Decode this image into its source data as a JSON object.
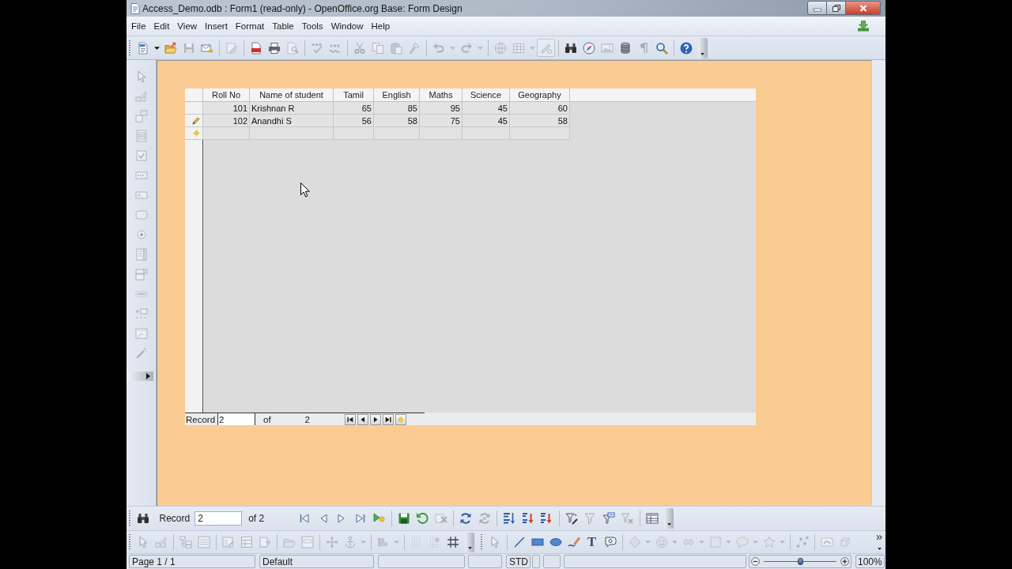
{
  "window": {
    "title": "Access_Demo.odb : Form1 (read-only) - OpenOffice.org Base: Form Design"
  },
  "menu": [
    {
      "label": "File"
    },
    {
      "label": "Edit"
    },
    {
      "label": "View"
    },
    {
      "label": "Insert"
    },
    {
      "label": "Format"
    },
    {
      "label": "Table"
    },
    {
      "label": "Tools"
    },
    {
      "label": "Window"
    },
    {
      "label": "Help"
    }
  ],
  "standard_toolbar": [
    {
      "kind": "new",
      "disabled": false,
      "pressed": false
    },
    {
      "kind": "dropdown",
      "disabled": false,
      "pressed": false
    },
    {
      "kind": "open",
      "disabled": false,
      "pressed": false
    },
    {
      "kind": "save",
      "disabled": true,
      "pressed": false
    },
    {
      "kind": "email",
      "disabled": false,
      "pressed": false
    },
    {
      "kind": "separator"
    },
    {
      "kind": "edit-file",
      "disabled": true,
      "pressed": false
    },
    {
      "kind": "separator"
    },
    {
      "kind": "pdf",
      "disabled": false,
      "pressed": false
    },
    {
      "kind": "print",
      "disabled": false,
      "pressed": false
    },
    {
      "kind": "preview",
      "disabled": true,
      "pressed": false
    },
    {
      "kind": "separator"
    },
    {
      "kind": "spellcheck",
      "disabled": true,
      "pressed": false
    },
    {
      "kind": "autospell",
      "disabled": true,
      "pressed": false
    },
    {
      "kind": "separator"
    },
    {
      "kind": "cut",
      "disabled": true,
      "pressed": false
    },
    {
      "kind": "copy",
      "disabled": true,
      "pressed": false
    },
    {
      "kind": "paste",
      "disabled": true,
      "pressed": false
    },
    {
      "kind": "clone",
      "disabled": true,
      "pressed": false
    },
    {
      "kind": "separator"
    },
    {
      "kind": "undo",
      "disabled": true,
      "pressed": false
    },
    {
      "kind": "dropdown",
      "disabled": true,
      "pressed": false
    },
    {
      "kind": "redo",
      "disabled": true,
      "pressed": false
    },
    {
      "kind": "dropdown",
      "disabled": true,
      "pressed": false
    },
    {
      "kind": "separator"
    },
    {
      "kind": "hyperlink",
      "disabled": true,
      "pressed": false
    },
    {
      "kind": "table",
      "disabled": true,
      "pressed": false
    },
    {
      "kind": "dropdown",
      "disabled": true,
      "pressed": false
    },
    {
      "kind": "draw",
      "disabled": true,
      "pressed": true
    },
    {
      "kind": "separator"
    },
    {
      "kind": "find",
      "disabled": false,
      "pressed": false
    },
    {
      "kind": "navigator",
      "disabled": false,
      "pressed": false
    },
    {
      "kind": "gallery",
      "disabled": true,
      "pressed": false
    },
    {
      "kind": "datasource",
      "disabled": false,
      "pressed": false
    },
    {
      "kind": "nonprint",
      "disabled": true,
      "pressed": false
    },
    {
      "kind": "zoom",
      "disabled": false,
      "pressed": false
    },
    {
      "kind": "separator"
    },
    {
      "kind": "help",
      "disabled": false,
      "pressed": false
    },
    {
      "kind": "overflow"
    }
  ],
  "form_controls_toolbar": [
    {
      "kind": "pointer",
      "disabled": true
    },
    {
      "kind": "design-mode",
      "disabled": true
    },
    {
      "kind": "wizard",
      "disabled": true
    },
    {
      "kind": "form",
      "disabled": true
    },
    {
      "kind": "checkbox",
      "disabled": true
    },
    {
      "kind": "textbox",
      "disabled": true
    },
    {
      "kind": "formatted",
      "disabled": true
    },
    {
      "kind": "push-button",
      "disabled": true
    },
    {
      "kind": "option",
      "disabled": true
    },
    {
      "kind": "listbox",
      "disabled": true
    },
    {
      "kind": "combobox",
      "disabled": true
    },
    {
      "kind": "label",
      "disabled": true
    },
    {
      "kind": "more-controls",
      "disabled": true
    },
    {
      "kind": "form-design",
      "disabled": true
    },
    {
      "kind": "wizards",
      "disabled": true
    },
    {
      "kind": "expand"
    }
  ],
  "form": {
    "grid": {
      "columns": [
        {
          "label": "Roll No",
          "kind": "number"
        },
        {
          "label": "Name of student",
          "kind": "text"
        },
        {
          "label": "Tamil",
          "kind": "number"
        },
        {
          "label": "English",
          "kind": "number"
        },
        {
          "label": "Maths",
          "kind": "number"
        },
        {
          "label": "Science",
          "kind": "number"
        },
        {
          "label": "Geography",
          "kind": "number"
        }
      ],
      "rows": [
        {
          "editing": false,
          "new": false,
          "cells": [
            "101",
            "Krishnan R",
            "65",
            "85",
            "95",
            "45",
            "60"
          ]
        },
        {
          "editing": true,
          "new": false,
          "cells": [
            "102",
            "Anandhi S",
            "56",
            "58",
            "75",
            "45",
            "58"
          ]
        },
        {
          "editing": false,
          "new": true
        }
      ]
    },
    "record_bar": {
      "label": "Record",
      "value": "2",
      "of": "of",
      "total": "2",
      "buttons": [
        {
          "kind": "first"
        },
        {
          "kind": "prev"
        },
        {
          "kind": "next"
        },
        {
          "kind": "last"
        },
        {
          "kind": "new-record"
        }
      ]
    }
  },
  "navigation_toolbar": {
    "leading_buttons": [
      {
        "kind": "find",
        "disabled": false
      }
    ],
    "record_label": "Record",
    "record_value": "2",
    "count": "of 2",
    "buttons": [
      {
        "kind": "first",
        "disabled": false
      },
      {
        "kind": "prev",
        "disabled": false
      },
      {
        "kind": "next",
        "disabled": false
      },
      {
        "kind": "last",
        "disabled": false
      },
      {
        "kind": "new-record",
        "disabled": false
      },
      {
        "kind": "separator"
      },
      {
        "kind": "save-record",
        "disabled": false
      },
      {
        "kind": "undo-record",
        "disabled": false
      },
      {
        "kind": "delete-record",
        "disabled": true
      },
      {
        "kind": "separator"
      },
      {
        "kind": "refresh",
        "disabled": false
      },
      {
        "kind": "refresh-control",
        "disabled": true
      },
      {
        "kind": "separator"
      },
      {
        "kind": "sort",
        "disabled": false
      },
      {
        "kind": "sort-asc",
        "disabled": false
      },
      {
        "kind": "sort-desc",
        "disabled": false
      },
      {
        "kind": "separator"
      },
      {
        "kind": "autofilter",
        "disabled": false
      },
      {
        "kind": "apply-filter",
        "disabled": true
      },
      {
        "kind": "standard-filter",
        "disabled": false
      },
      {
        "kind": "reset-filter",
        "disabled": true
      },
      {
        "kind": "separator"
      },
      {
        "kind": "data-table",
        "disabled": false
      },
      {
        "kind": "overflow"
      }
    ]
  },
  "form_design_toolbar": [
    {
      "kind": "pointer",
      "disabled": true
    },
    {
      "kind": "design-mode",
      "disabled": true
    },
    {
      "kind": "separator"
    },
    {
      "kind": "form-navigator",
      "disabled": true
    },
    {
      "kind": "add-field",
      "disabled": true
    },
    {
      "kind": "separator"
    },
    {
      "kind": "control-properties",
      "disabled": true
    },
    {
      "kind": "form-properties",
      "disabled": true
    },
    {
      "kind": "activation-order",
      "disabled": true
    },
    {
      "kind": "separator"
    },
    {
      "kind": "open-design",
      "disabled": true
    },
    {
      "kind": "focus",
      "disabled": true
    },
    {
      "kind": "separator"
    },
    {
      "kind": "position",
      "disabled": true
    },
    {
      "kind": "anchor",
      "disabled": true
    },
    {
      "kind": "dropdown",
      "disabled": true
    },
    {
      "kind": "separator"
    },
    {
      "kind": "align",
      "disabled": true
    },
    {
      "kind": "dropdown",
      "disabled": true
    },
    {
      "kind": "separator"
    },
    {
      "kind": "grid",
      "disabled": true
    },
    {
      "kind": "snap",
      "disabled": true
    },
    {
      "kind": "guides",
      "disabled": false
    },
    {
      "kind": "overflow"
    }
  ],
  "drawing_toolbar": [
    {
      "kind": "pointer",
      "disabled": true
    },
    {
      "kind": "separator"
    },
    {
      "kind": "line",
      "disabled": false
    },
    {
      "kind": "rectangle",
      "disabled": false
    },
    {
      "kind": "ellipse",
      "disabled": false
    },
    {
      "kind": "freeform",
      "disabled": false
    },
    {
      "kind": "text",
      "glyph": "T",
      "disabled": false
    },
    {
      "kind": "callout",
      "disabled": false
    },
    {
      "kind": "separator"
    },
    {
      "kind": "basic-shapes",
      "disabled": true
    },
    {
      "kind": "dropdown",
      "disabled": true
    },
    {
      "kind": "symbol-shapes",
      "disabled": true
    },
    {
      "kind": "dropdown",
      "disabled": true
    },
    {
      "kind": "block-arrows",
      "disabled": true
    },
    {
      "kind": "dropdown",
      "disabled": true
    },
    {
      "kind": "flowchart",
      "disabled": true
    },
    {
      "kind": "dropdown",
      "disabled": true
    },
    {
      "kind": "callouts",
      "disabled": true
    },
    {
      "kind": "dropdown",
      "disabled": true
    },
    {
      "kind": "stars",
      "disabled": true
    },
    {
      "kind": "dropdown",
      "disabled": true
    },
    {
      "kind": "separator"
    },
    {
      "kind": "points",
      "disabled": true
    },
    {
      "kind": "separator"
    },
    {
      "kind": "fontwork",
      "disabled": true
    },
    {
      "kind": "extrusion",
      "disabled": true
    },
    {
      "kind": "more"
    }
  ],
  "status_bar": {
    "page": "Page 1 / 1",
    "page_style": "Default",
    "selection_mode": "STD",
    "zoom": {
      "level": 0.5,
      "reading": "100%"
    }
  }
}
